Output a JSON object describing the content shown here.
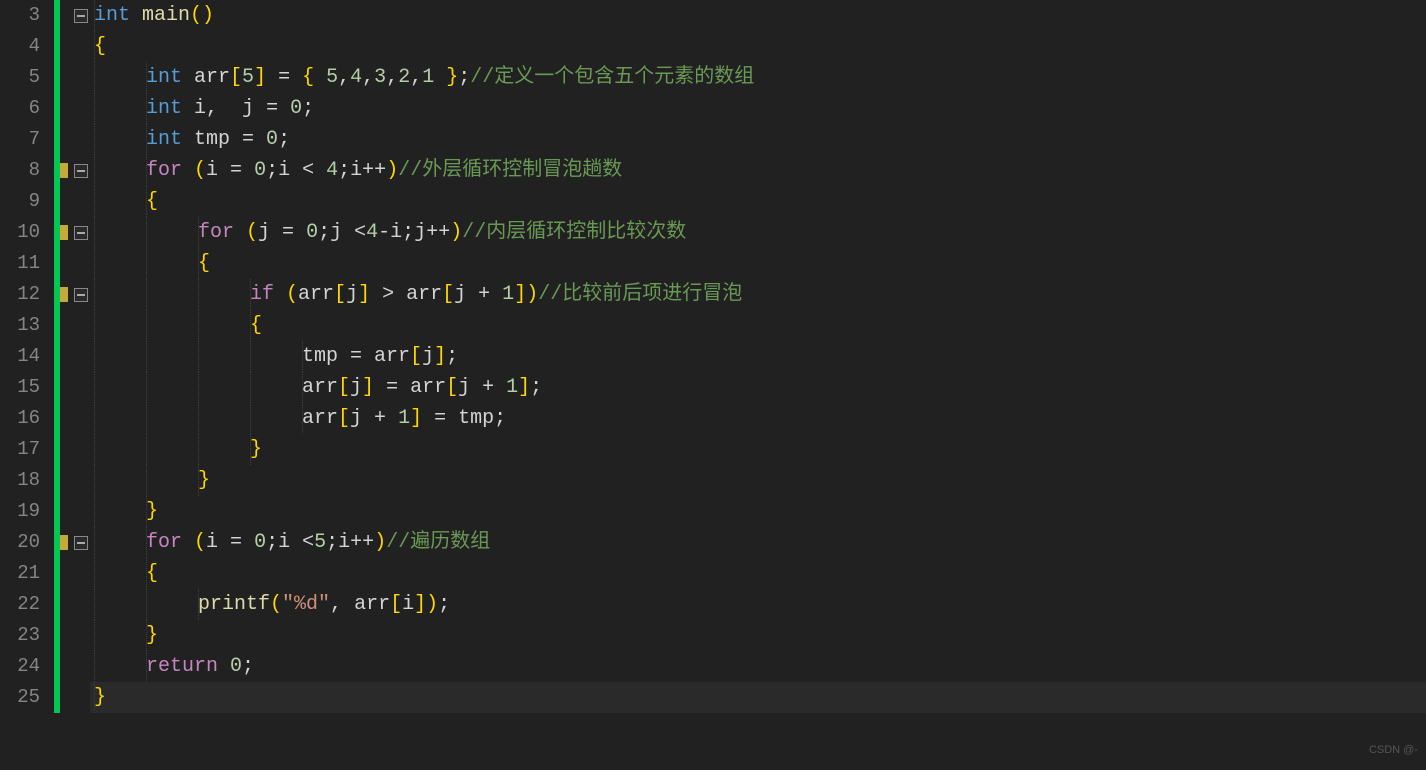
{
  "watermark": "CSDN @-",
  "lines": [
    {
      "n": 3,
      "changed": true,
      "bp": false,
      "fold": true,
      "indent": 0,
      "segs": [
        {
          "c": "type",
          "t": "int "
        },
        {
          "c": "fn",
          "t": "main"
        },
        {
          "c": "br",
          "t": "()"
        }
      ]
    },
    {
      "n": 4,
      "changed": true,
      "bp": false,
      "fold": false,
      "indent": 0,
      "segs": [
        {
          "c": "br",
          "t": "{"
        }
      ]
    },
    {
      "n": 5,
      "changed": true,
      "bp": false,
      "fold": false,
      "indent": 1,
      "segs": [
        {
          "c": "type",
          "t": "int "
        },
        {
          "c": "id",
          "t": "arr"
        },
        {
          "c": "br",
          "t": "["
        },
        {
          "c": "num",
          "t": "5"
        },
        {
          "c": "br",
          "t": "]"
        },
        {
          "c": "op",
          "t": " = "
        },
        {
          "c": "br",
          "t": "{ "
        },
        {
          "c": "num",
          "t": "5"
        },
        {
          "c": "op",
          "t": ","
        },
        {
          "c": "num",
          "t": "4"
        },
        {
          "c": "op",
          "t": ","
        },
        {
          "c": "num",
          "t": "3"
        },
        {
          "c": "op",
          "t": ","
        },
        {
          "c": "num",
          "t": "2"
        },
        {
          "c": "op",
          "t": ","
        },
        {
          "c": "num",
          "t": "1"
        },
        {
          "c": "br",
          "t": " }"
        },
        {
          "c": "op",
          "t": ";"
        },
        {
          "c": "cmt",
          "t": "//定义一个包含五个元素的数组"
        }
      ]
    },
    {
      "n": 6,
      "changed": true,
      "bp": false,
      "fold": false,
      "indent": 1,
      "segs": [
        {
          "c": "type",
          "t": "int "
        },
        {
          "c": "id",
          "t": "i"
        },
        {
          "c": "op",
          "t": ",  "
        },
        {
          "c": "id",
          "t": "j"
        },
        {
          "c": "op",
          "t": " = "
        },
        {
          "c": "num",
          "t": "0"
        },
        {
          "c": "op",
          "t": ";"
        }
      ]
    },
    {
      "n": 7,
      "changed": true,
      "bp": false,
      "fold": false,
      "indent": 1,
      "segs": [
        {
          "c": "type",
          "t": "int "
        },
        {
          "c": "id",
          "t": "tmp"
        },
        {
          "c": "op",
          "t": " = "
        },
        {
          "c": "num",
          "t": "0"
        },
        {
          "c": "op",
          "t": ";"
        }
      ]
    },
    {
      "n": 8,
      "changed": true,
      "bp": true,
      "fold": true,
      "indent": 1,
      "segs": [
        {
          "c": "kw",
          "t": "for "
        },
        {
          "c": "br",
          "t": "("
        },
        {
          "c": "id",
          "t": "i"
        },
        {
          "c": "op",
          "t": " = "
        },
        {
          "c": "num",
          "t": "0"
        },
        {
          "c": "op",
          "t": ";"
        },
        {
          "c": "id",
          "t": "i"
        },
        {
          "c": "op",
          "t": " < "
        },
        {
          "c": "num",
          "t": "4"
        },
        {
          "c": "op",
          "t": ";"
        },
        {
          "c": "id",
          "t": "i"
        },
        {
          "c": "op",
          "t": "++"
        },
        {
          "c": "br",
          "t": ")"
        },
        {
          "c": "cmt",
          "t": "//外层循环控制冒泡趟数"
        }
      ]
    },
    {
      "n": 9,
      "changed": true,
      "bp": false,
      "fold": false,
      "indent": 1,
      "segs": [
        {
          "c": "br",
          "t": "{"
        }
      ]
    },
    {
      "n": 10,
      "changed": true,
      "bp": true,
      "fold": true,
      "indent": 2,
      "segs": [
        {
          "c": "kw",
          "t": "for "
        },
        {
          "c": "br",
          "t": "("
        },
        {
          "c": "id",
          "t": "j"
        },
        {
          "c": "op",
          "t": " = "
        },
        {
          "c": "num",
          "t": "0"
        },
        {
          "c": "op",
          "t": ";"
        },
        {
          "c": "id",
          "t": "j"
        },
        {
          "c": "op",
          "t": " <"
        },
        {
          "c": "num",
          "t": "4"
        },
        {
          "c": "op",
          "t": "-"
        },
        {
          "c": "id",
          "t": "i"
        },
        {
          "c": "op",
          "t": ";"
        },
        {
          "c": "id",
          "t": "j"
        },
        {
          "c": "op",
          "t": "++"
        },
        {
          "c": "br",
          "t": ")"
        },
        {
          "c": "cmt",
          "t": "//内层循环控制比较次数"
        }
      ]
    },
    {
      "n": 11,
      "changed": true,
      "bp": false,
      "fold": false,
      "indent": 2,
      "segs": [
        {
          "c": "br",
          "t": "{"
        }
      ]
    },
    {
      "n": 12,
      "changed": true,
      "bp": true,
      "fold": true,
      "indent": 3,
      "segs": [
        {
          "c": "kw",
          "t": "if "
        },
        {
          "c": "br",
          "t": "("
        },
        {
          "c": "id",
          "t": "arr"
        },
        {
          "c": "br",
          "t": "["
        },
        {
          "c": "id",
          "t": "j"
        },
        {
          "c": "br",
          "t": "]"
        },
        {
          "c": "op",
          "t": " > "
        },
        {
          "c": "id",
          "t": "arr"
        },
        {
          "c": "br",
          "t": "["
        },
        {
          "c": "id",
          "t": "j"
        },
        {
          "c": "op",
          "t": " + "
        },
        {
          "c": "num",
          "t": "1"
        },
        {
          "c": "br",
          "t": "]"
        },
        {
          "c": "br",
          "t": ")"
        },
        {
          "c": "cmt",
          "t": "//比较前后项进行冒泡"
        }
      ]
    },
    {
      "n": 13,
      "changed": true,
      "bp": false,
      "fold": false,
      "indent": 3,
      "segs": [
        {
          "c": "br",
          "t": "{"
        }
      ]
    },
    {
      "n": 14,
      "changed": true,
      "bp": false,
      "fold": false,
      "indent": 4,
      "segs": [
        {
          "c": "id",
          "t": "tmp"
        },
        {
          "c": "op",
          "t": " = "
        },
        {
          "c": "id",
          "t": "arr"
        },
        {
          "c": "br",
          "t": "["
        },
        {
          "c": "id",
          "t": "j"
        },
        {
          "c": "br",
          "t": "]"
        },
        {
          "c": "op",
          "t": ";"
        }
      ]
    },
    {
      "n": 15,
      "changed": true,
      "bp": false,
      "fold": false,
      "indent": 4,
      "segs": [
        {
          "c": "id",
          "t": "arr"
        },
        {
          "c": "br",
          "t": "["
        },
        {
          "c": "id",
          "t": "j"
        },
        {
          "c": "br",
          "t": "]"
        },
        {
          "c": "op",
          "t": " = "
        },
        {
          "c": "id",
          "t": "arr"
        },
        {
          "c": "br",
          "t": "["
        },
        {
          "c": "id",
          "t": "j"
        },
        {
          "c": "op",
          "t": " + "
        },
        {
          "c": "num",
          "t": "1"
        },
        {
          "c": "br",
          "t": "]"
        },
        {
          "c": "op",
          "t": ";"
        }
      ]
    },
    {
      "n": 16,
      "changed": true,
      "bp": false,
      "fold": false,
      "indent": 4,
      "segs": [
        {
          "c": "id",
          "t": "arr"
        },
        {
          "c": "br",
          "t": "["
        },
        {
          "c": "id",
          "t": "j"
        },
        {
          "c": "op",
          "t": " + "
        },
        {
          "c": "num",
          "t": "1"
        },
        {
          "c": "br",
          "t": "]"
        },
        {
          "c": "op",
          "t": " = "
        },
        {
          "c": "id",
          "t": "tmp"
        },
        {
          "c": "op",
          "t": ";"
        }
      ]
    },
    {
      "n": 17,
      "changed": true,
      "bp": false,
      "fold": false,
      "indent": 3,
      "segs": [
        {
          "c": "br",
          "t": "}"
        }
      ]
    },
    {
      "n": 18,
      "changed": true,
      "bp": false,
      "fold": false,
      "indent": 2,
      "segs": [
        {
          "c": "br",
          "t": "}"
        }
      ]
    },
    {
      "n": 19,
      "changed": true,
      "bp": false,
      "fold": false,
      "indent": 1,
      "segs": [
        {
          "c": "br",
          "t": "}"
        }
      ]
    },
    {
      "n": 20,
      "changed": true,
      "bp": true,
      "fold": true,
      "indent": 1,
      "segs": [
        {
          "c": "kw",
          "t": "for "
        },
        {
          "c": "br",
          "t": "("
        },
        {
          "c": "id",
          "t": "i"
        },
        {
          "c": "op",
          "t": " = "
        },
        {
          "c": "num",
          "t": "0"
        },
        {
          "c": "op",
          "t": ";"
        },
        {
          "c": "id",
          "t": "i"
        },
        {
          "c": "op",
          "t": " <"
        },
        {
          "c": "num",
          "t": "5"
        },
        {
          "c": "op",
          "t": ";"
        },
        {
          "c": "id",
          "t": "i"
        },
        {
          "c": "op",
          "t": "++"
        },
        {
          "c": "br",
          "t": ")"
        },
        {
          "c": "cmt",
          "t": "//遍历数组"
        }
      ]
    },
    {
      "n": 21,
      "changed": true,
      "bp": false,
      "fold": false,
      "indent": 1,
      "segs": [
        {
          "c": "br",
          "t": "{"
        }
      ]
    },
    {
      "n": 22,
      "changed": true,
      "bp": false,
      "fold": false,
      "indent": 2,
      "segs": [
        {
          "c": "fn",
          "t": "printf"
        },
        {
          "c": "br",
          "t": "("
        },
        {
          "c": "str",
          "t": "\"%d\""
        },
        {
          "c": "op",
          "t": ", "
        },
        {
          "c": "id",
          "t": "arr"
        },
        {
          "c": "br",
          "t": "["
        },
        {
          "c": "id",
          "t": "i"
        },
        {
          "c": "br",
          "t": "]"
        },
        {
          "c": "br",
          "t": ")"
        },
        {
          "c": "op",
          "t": ";"
        }
      ]
    },
    {
      "n": 23,
      "changed": true,
      "bp": false,
      "fold": false,
      "indent": 1,
      "segs": [
        {
          "c": "br",
          "t": "}"
        }
      ]
    },
    {
      "n": 24,
      "changed": true,
      "bp": false,
      "fold": false,
      "indent": 1,
      "segs": [
        {
          "c": "kw",
          "t": "return "
        },
        {
          "c": "num",
          "t": "0"
        },
        {
          "c": "op",
          "t": ";"
        }
      ]
    },
    {
      "n": 25,
      "changed": true,
      "bp": false,
      "fold": false,
      "indent": 0,
      "cursor": true,
      "segs": [
        {
          "c": "br",
          "t": "}"
        }
      ]
    }
  ]
}
